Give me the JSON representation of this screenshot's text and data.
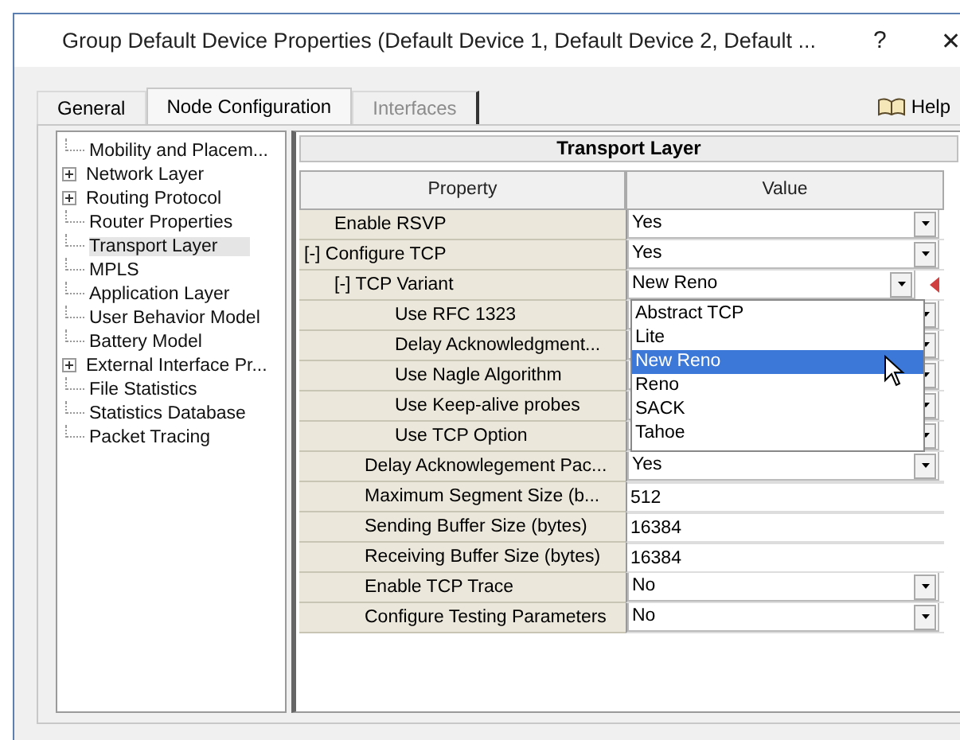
{
  "window": {
    "title": "Group Default Device Properties (Default Device 1, Default Device 2, Default ...",
    "help_glyph": "?",
    "close_glyph": "✕"
  },
  "tabs": [
    {
      "label": "General",
      "selected": false,
      "disabled": false
    },
    {
      "label": "Node Configuration",
      "selected": true,
      "disabled": false
    },
    {
      "label": "Interfaces",
      "selected": false,
      "disabled": true
    }
  ],
  "help_button": {
    "label": "Help"
  },
  "tree": [
    {
      "label": "Mobility and Placem...",
      "expandable": false,
      "selected": false
    },
    {
      "label": "Network Layer",
      "expandable": true,
      "selected": false
    },
    {
      "label": "Routing Protocol",
      "expandable": true,
      "selected": false
    },
    {
      "label": "Router Properties",
      "expandable": false,
      "selected": false
    },
    {
      "label": "Transport Layer",
      "expandable": false,
      "selected": true
    },
    {
      "label": "MPLS",
      "expandable": false,
      "selected": false
    },
    {
      "label": "Application Layer",
      "expandable": false,
      "selected": false
    },
    {
      "label": "User Behavior Model",
      "expandable": false,
      "selected": false
    },
    {
      "label": "Battery Model",
      "expandable": false,
      "selected": false
    },
    {
      "label": "External Interface Pr...",
      "expandable": true,
      "selected": false
    },
    {
      "label": "File Statistics",
      "expandable": false,
      "selected": false
    },
    {
      "label": "Statistics Database",
      "expandable": false,
      "selected": false
    },
    {
      "label": "Packet Tracing",
      "expandable": false,
      "selected": false
    }
  ],
  "panel": {
    "title": "Transport Layer",
    "columns": [
      "Property",
      "Value"
    ],
    "rows": [
      {
        "label": "Enable RSVP",
        "kind": "dropdown",
        "value": "Yes"
      },
      {
        "label": "Configure TCP",
        "expander": "[-]",
        "kind": "dropdown",
        "value": "Yes",
        "children": [
          {
            "label": "TCP Variant",
            "expander": "[-]",
            "kind": "dropdown",
            "value": "New Reno",
            "options": [
              {
                "label": "Abstract TCP",
                "selected": false
              },
              {
                "label": "Lite",
                "selected": false
              },
              {
                "label": "New Reno",
                "selected": true
              },
              {
                "label": "Reno",
                "selected": false
              },
              {
                "label": "SACK",
                "selected": false
              },
              {
                "label": "Tahoe",
                "selected": false
              }
            ],
            "children": [
              {
                "label": "Use RFC 1323",
                "kind": "dropdown"
              },
              {
                "label": "Delay Acknowledgment...",
                "kind": "dropdown"
              },
              {
                "label": "Use Nagle Algorithm",
                "kind": "dropdown"
              },
              {
                "label": "Use Keep-alive probes",
                "kind": "dropdown"
              },
              {
                "label": "Use TCP Option",
                "kind": "dropdown"
              }
            ]
          },
          {
            "label": "Delay Acknowlegement Pac...",
            "kind": "dropdown",
            "value": "Yes"
          },
          {
            "label": "Maximum Segment Size (b...",
            "kind": "text",
            "value": "512"
          },
          {
            "label": "Sending Buffer Size (bytes)",
            "kind": "text",
            "value": "16384"
          },
          {
            "label": "Receiving Buffer Size (bytes)",
            "kind": "text",
            "value": "16384"
          },
          {
            "label": "Enable TCP Trace",
            "kind": "dropdown",
            "value": "No"
          },
          {
            "label": "Configure Testing Parameters",
            "kind": "dropdown",
            "value": "No"
          }
        ]
      }
    ]
  }
}
